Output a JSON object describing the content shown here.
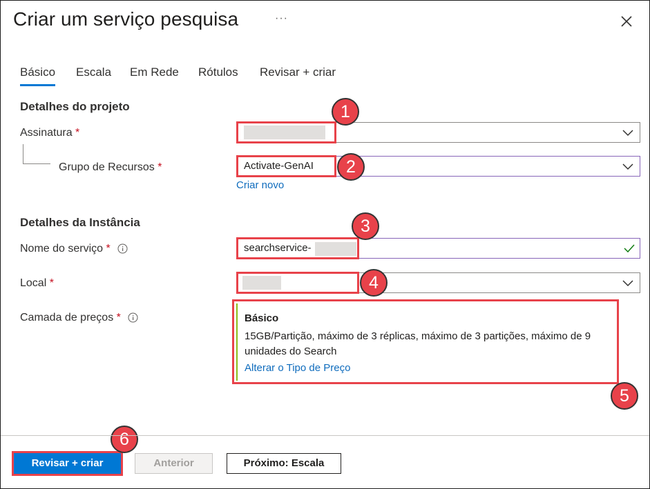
{
  "header": {
    "title": "Criar um serviço pesquisa",
    "more_label": "···"
  },
  "tabs": [
    {
      "label": "Básico",
      "selected": true
    },
    {
      "label": "Escala"
    },
    {
      "label": "Em Rede"
    },
    {
      "label": "Rótulos"
    },
    {
      "label": "Revisar + criar"
    }
  ],
  "project": {
    "heading": "Detalhes do projeto",
    "subscription": {
      "label": "Assinatura",
      "value": ""
    },
    "resource_group": {
      "label": "Grupo de Recursos",
      "value": "Activate-GenAI"
    },
    "create_new": "Criar novo"
  },
  "instance": {
    "heading": "Detalhes da Instância",
    "service_name": {
      "label": "Nome do serviço",
      "value": "searchservice-"
    },
    "location": {
      "label": "Local",
      "value": ""
    },
    "pricing": {
      "label": "Camada de preços",
      "tier": "Básico",
      "description": "15GB/Partição, máximo de 3 réplicas, máximo de 3 partições, máximo de 9 unidades do Search",
      "change_link": "Alterar o Tipo de Preço"
    }
  },
  "required_marker": "*",
  "badges": [
    "1",
    "2",
    "3",
    "4",
    "5",
    "6"
  ],
  "footer": {
    "review_create": "Revisar + criar",
    "previous": "Anterior",
    "next": "Próximo: Escala"
  },
  "colors": {
    "accent": "#0078d4",
    "annotation": "#e8424a",
    "tier_bar": "#8cbd18",
    "valid_check": "#107c10"
  }
}
